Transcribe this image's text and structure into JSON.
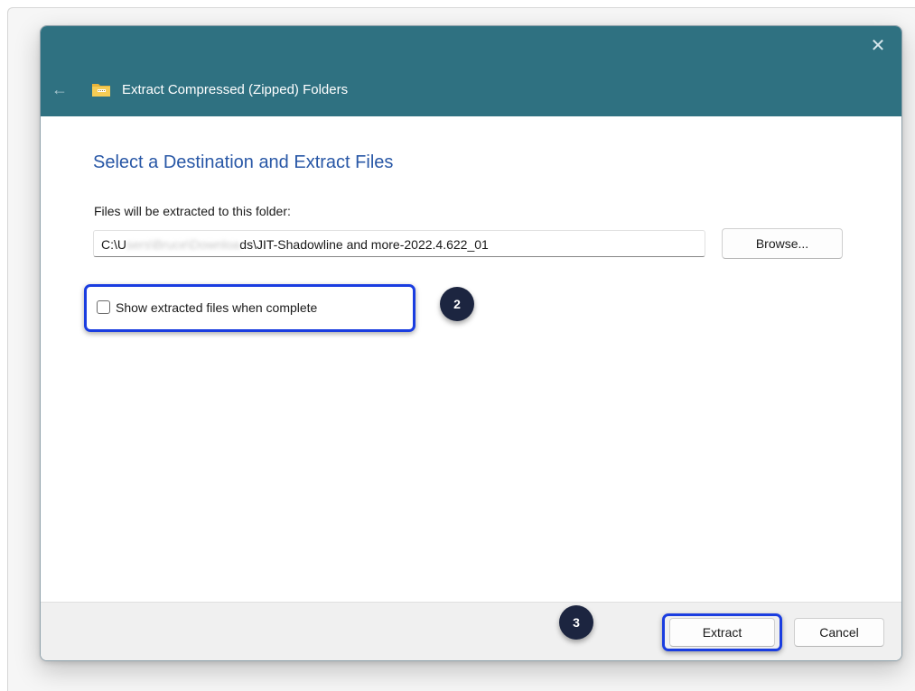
{
  "dialog": {
    "title": "Extract Compressed (Zipped) Folders",
    "close_glyph": "✕",
    "back_glyph": "←",
    "heading": "Select a Destination and Extract Files",
    "path_label": "Files will be extracted to this folder:",
    "path": {
      "prefix": "C:\\U",
      "redacted": "sers\\Bruce\\Downloa",
      "suffix": "ds\\JIT-Shadowline and more-2022.4.622_01"
    },
    "browse_label": "Browse...",
    "checkbox_label": "Show extracted files when complete",
    "checkbox_checked": false,
    "extract_label": "Extract",
    "cancel_label": "Cancel"
  },
  "annotations": {
    "step2": "2",
    "step3": "3",
    "highlight_color": "#1a3de0",
    "badge_color": "#1c2540"
  },
  "icons": {
    "window": "zip-folder-icon",
    "back": "back-arrow-icon",
    "close": "close-icon"
  },
  "colors": {
    "titlebar": "#2f7181",
    "heading": "#2857a6"
  }
}
